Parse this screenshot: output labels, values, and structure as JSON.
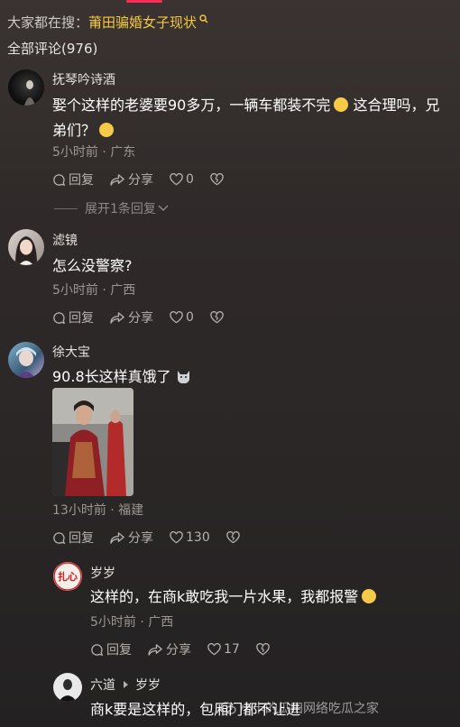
{
  "search": {
    "prefix": "大家都在搜：",
    "keyword": "莆田骗婚女子现状"
  },
  "comments_count": "全部评论(976)",
  "comments": [
    {
      "user": "抚琴吟诗酒",
      "text_line1": "娶个这样的老婆要90多万，一辆车都装不完",
      "text_line1b": " 这合理吗，兄",
      "text_line2": "弟们？",
      "meta": "5小时前 · 广东",
      "reply": "回复",
      "share": "分享",
      "likes": "0"
    },
    {
      "user": "滤镜",
      "text": "怎么没警察?",
      "meta": "5小时前 · 广西",
      "reply": "回复",
      "share": "分享",
      "likes": "0"
    },
    {
      "user": "徐大宝",
      "text": "90.8长这样真饿了",
      "meta": "13小时前 · 福建",
      "reply": "回复",
      "share": "分享",
      "likes": "130"
    }
  ],
  "expand_replies": "展开1条回复",
  "replies": [
    {
      "user": "岁岁",
      "text": "这样的，在商k敢吃我一片水果，我都报警",
      "meta": "5小时前 · 广西",
      "reply": "回复",
      "share": "分享",
      "likes": "17"
    },
    {
      "user": "六道",
      "reply_to": "岁岁",
      "text": "商k要是这样的，包厢门都不让进"
    }
  ],
  "watermark": "小卡的瓜田网络吃瓜之家",
  "avatar_badge": "扎心",
  "colors": {
    "keyword": "#f5c842",
    "accent": "#fe2c55"
  }
}
